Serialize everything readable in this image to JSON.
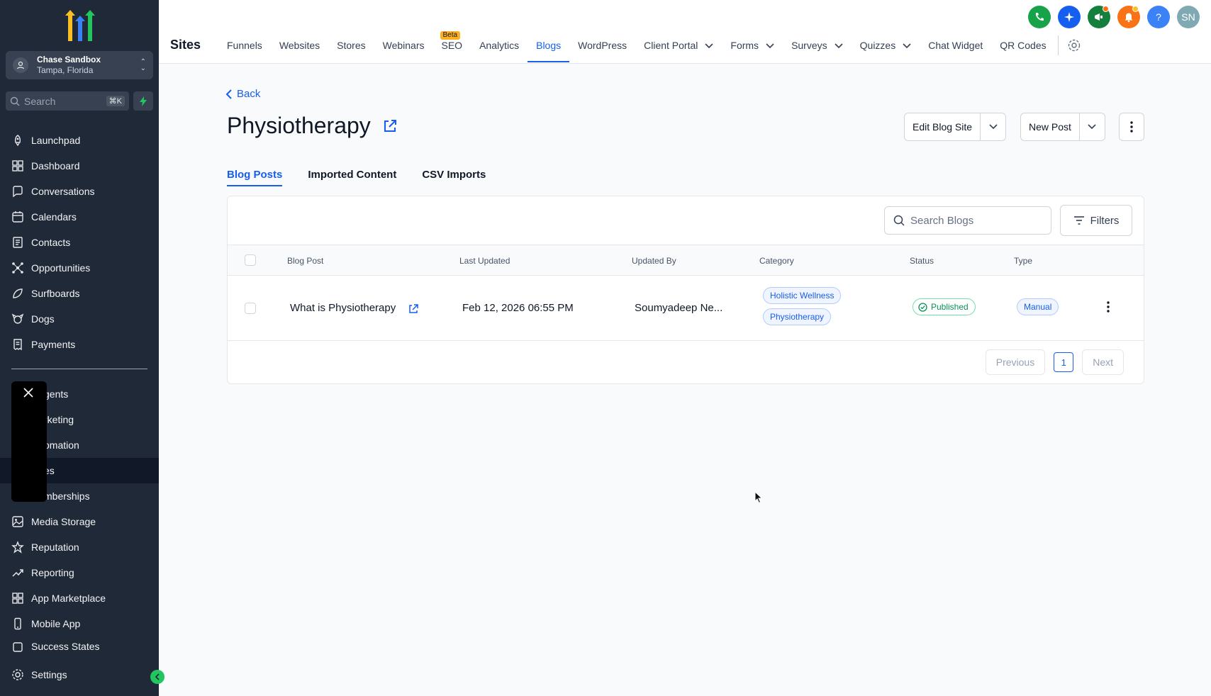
{
  "sidebar": {
    "account_name": "Chase Sandbox",
    "account_location": "Tampa, Florida",
    "search_placeholder": "Search",
    "search_shortcut": "⌘K",
    "items": [
      {
        "label": "Launchpad",
        "icon": "rocket-icon"
      },
      {
        "label": "Dashboard",
        "icon": "grid-icon"
      },
      {
        "label": "Conversations",
        "icon": "chat-icon"
      },
      {
        "label": "Calendars",
        "icon": "calendar-icon"
      },
      {
        "label": "Contacts",
        "icon": "contacts-icon"
      },
      {
        "label": "Opportunities",
        "icon": "network-icon"
      },
      {
        "label": "Surfboards",
        "icon": "surfboard-icon"
      },
      {
        "label": "Dogs",
        "icon": "dog-icon"
      },
      {
        "label": "Payments",
        "icon": "receipt-icon"
      }
    ],
    "partial_items": [
      "gents",
      "rketing",
      "omation",
      "es",
      "mberships"
    ],
    "items2": [
      {
        "label": "Media Storage",
        "icon": "image-icon"
      },
      {
        "label": "Reputation",
        "icon": "star-icon"
      },
      {
        "label": "Reporting",
        "icon": "trend-icon"
      },
      {
        "label": "App Marketplace",
        "icon": "apps-icon"
      },
      {
        "label": "Mobile App",
        "icon": "phone-icon"
      }
    ],
    "cutoff_item": "Success States",
    "settings_label": "Settings"
  },
  "topbar": {
    "title": "Sites",
    "tabs": [
      {
        "label": "Funnels"
      },
      {
        "label": "Websites"
      },
      {
        "label": "Stores"
      },
      {
        "label": "Webinars"
      },
      {
        "label": "SEO",
        "badge": "Beta"
      },
      {
        "label": "Analytics"
      },
      {
        "label": "Blogs",
        "active": true
      },
      {
        "label": "WordPress"
      },
      {
        "label": "Client Portal",
        "dropdown": true
      },
      {
        "label": "Forms",
        "dropdown": true
      },
      {
        "label": "Surveys",
        "dropdown": true
      },
      {
        "label": "Quizzes",
        "dropdown": true
      },
      {
        "label": "Chat Widget"
      },
      {
        "label": "QR Codes"
      }
    ],
    "avatar_initials": "SN",
    "help_glyph": "?",
    "colors": {
      "phone": "#16a34a",
      "ai": "#155eef",
      "megaphone": "#15803d",
      "bell": "#f97316",
      "help": "#3b82f6",
      "avatar": "#7fa9b3"
    }
  },
  "page": {
    "back_label": "Back",
    "title": "Physiotherapy",
    "edit_blog_site": "Edit Blog Site",
    "new_post": "New Post",
    "subtabs": [
      "Blog Posts",
      "Imported Content",
      "CSV Imports"
    ],
    "search_placeholder": "Search Blogs",
    "filters_label": "Filters",
    "columns": [
      "Blog Post",
      "Last Updated",
      "Updated By",
      "Category",
      "Status",
      "Type"
    ],
    "rows": [
      {
        "title": "What is Physiotherapy",
        "last_updated": "Feb 12, 2026 06:55 PM",
        "updated_by": "Soumyadeep Ne...",
        "categories": [
          "Holistic Wellness",
          "Physiotherapy"
        ],
        "status": "Published",
        "type": "Manual"
      }
    ],
    "pagination": {
      "previous": "Previous",
      "page": "1",
      "next": "Next"
    }
  }
}
